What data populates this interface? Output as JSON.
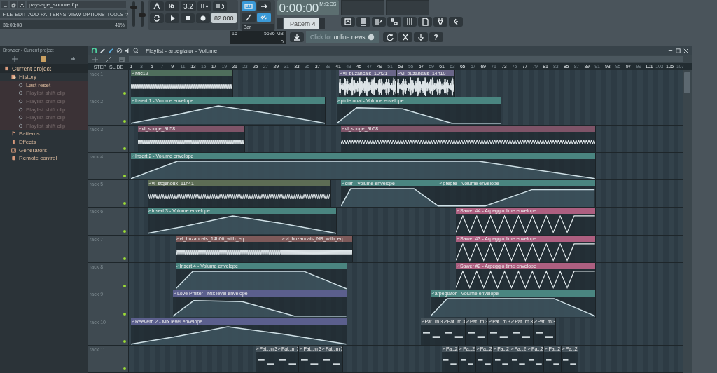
{
  "window": {
    "title": "paysage_sonore.flp"
  },
  "menu": [
    "FILE",
    "EDIT",
    "ADD",
    "PATTERNS",
    "VIEW",
    "OPTIONS",
    "TOOLS",
    "?"
  ],
  "status": {
    "time": "31:03:08",
    "cpu": "41%"
  },
  "master_volume": {
    "level": 0.8
  },
  "master_pitch": {
    "level": 0.45
  },
  "help": "?",
  "transport": {
    "meter": "3.2",
    "tempo": "82.000",
    "snap": "Bar",
    "song_time": "0:00:00",
    "time_unit": "M:S:CS",
    "pattern": "Pattern 4"
  },
  "memory": {
    "polyphony": "16",
    "ram": "5696 MB",
    "value": "0"
  },
  "news": {
    "label": "Click for ",
    "bold": "online news"
  },
  "browser": {
    "title": "Browser - Current project",
    "tree": [
      {
        "label": "Current project",
        "kind": "project",
        "disabled": false,
        "children": [
          {
            "label": "History",
            "kind": "history",
            "disabled": false,
            "children": [
              {
                "label": "Last reset",
                "kind": "step",
                "disabled": false
              },
              {
                "label": "Playlist shift clip",
                "kind": "step",
                "disabled": true
              },
              {
                "label": "Playlist shift clip",
                "kind": "step",
                "disabled": true
              },
              {
                "label": "Playlist shift clip",
                "kind": "step",
                "disabled": true
              },
              {
                "label": "Playlist shift clip",
                "kind": "step",
                "disabled": true
              },
              {
                "label": "Playlist shift clip",
                "kind": "step",
                "disabled": true
              }
            ]
          },
          {
            "label": "Patterns",
            "kind": "patterns",
            "disabled": false
          },
          {
            "label": "Effects",
            "kind": "effects",
            "disabled": false
          },
          {
            "label": "Generators",
            "kind": "generators",
            "disabled": false
          },
          {
            "label": "Remote control",
            "kind": "remote",
            "disabled": false
          }
        ]
      }
    ]
  },
  "playlist": {
    "title": "Playlist - arpegiator - Volume",
    "step_label": "STEP",
    "slide_label": "SLIDE",
    "ruler": [
      "1",
      "3",
      "5",
      "7",
      "9",
      "11",
      "13",
      "15",
      "17",
      "19",
      "21",
      "23",
      "25",
      "27",
      "29",
      "31",
      "33",
      "35",
      "37",
      "39",
      "41",
      "43",
      "45",
      "47",
      "49",
      "51",
      "53",
      "55",
      "57",
      "59",
      "61",
      "63",
      "65",
      "67",
      "69",
      "71",
      "73",
      "75",
      "77",
      "79",
      "81",
      "83",
      "85",
      "87",
      "89",
      "91",
      "93",
      "95",
      "97",
      "99",
      "101",
      "103",
      "105",
      "107"
    ],
    "tracks": [
      {
        "name": "rack 1",
        "enabled": true,
        "clips": [
          {
            "title": "Mic12",
            "kind": "audio",
            "color": "#4f6e5c"
          },
          {
            "title": "vl_buzancais_10h21",
            "kind": "audio",
            "color": "#6a6689"
          },
          {
            "title": "vl_buzancais_14h10",
            "kind": "audio",
            "color": "#6a6689"
          }
        ]
      },
      {
        "name": "rack 2",
        "enabled": true,
        "clips": [
          {
            "title": "Insert 1 - Volume envelope",
            "kind": "envelope",
            "color": "#4a8580"
          },
          {
            "title": "pluie ouai - Volume envelope",
            "kind": "envelope",
            "color": "#4a8580"
          }
        ]
      },
      {
        "name": "rack 3",
        "enabled": true,
        "clips": [
          {
            "title": "vl_souge_9h58",
            "kind": "audio",
            "color": "#7e5468"
          },
          {
            "title": "vl_souge_9h58",
            "kind": "audio",
            "color": "#7e5468"
          }
        ]
      },
      {
        "name": "rack 4",
        "enabled": true,
        "clips": [
          {
            "title": "Insert 2 - Volume envelope",
            "kind": "envelope",
            "color": "#4a8580"
          }
        ]
      },
      {
        "name": "rack 5",
        "enabled": true,
        "clips": [
          {
            "title": "vl_stgenoux_11h41",
            "kind": "audio",
            "color": "#5d6d55"
          },
          {
            "title": "clar - Volume envelope",
            "kind": "envelope",
            "color": "#4a8580"
          },
          {
            "title": "gregre - Volume envelope",
            "kind": "envelope",
            "color": "#4a8580"
          }
        ]
      },
      {
        "name": "rack 6",
        "enabled": true,
        "clips": [
          {
            "title": "Insert 3 - Volume envelope",
            "kind": "envelope",
            "color": "#4a8580"
          },
          {
            "title": "Sawer #4 - Arpeggio time envelope",
            "kind": "arpeggio",
            "color": "#ad5f80"
          }
        ]
      },
      {
        "name": "rack 7",
        "enabled": true,
        "clips": [
          {
            "title": "vl_buzancais_14h06_with_eq",
            "kind": "audio",
            "color": "#7e5a5a"
          },
          {
            "title": "vl_buzancais_NB_with_eq",
            "kind": "audio",
            "color": "#7e5a5a"
          },
          {
            "title": "Sawer #3 - Arpeggio time envelope",
            "kind": "arpeggio",
            "color": "#ad5f80"
          }
        ]
      },
      {
        "name": "rack 8",
        "enabled": true,
        "clips": [
          {
            "title": "Insert 4 - Volume envelope",
            "kind": "envelope",
            "color": "#4a8580"
          },
          {
            "title": "Sawer #2 - Arpeggio time envelope",
            "kind": "arpeggio",
            "color": "#ad5f80"
          }
        ]
      },
      {
        "name": "rack 9",
        "enabled": true,
        "clips": [
          {
            "title": "Love Philter - Mix level envelope",
            "kind": "envelope",
            "color": "#5b5f8d"
          },
          {
            "title": "arpegiator - Volume envelope",
            "kind": "envelope",
            "color": "#4a8580"
          }
        ]
      },
      {
        "name": "rack 10",
        "enabled": true,
        "clips": [
          {
            "title": "Reeverb 2 - Mix level envelope",
            "kind": "envelope",
            "color": "#5b5f8d"
          },
          {
            "title": "Pat...rn 3",
            "kind": "pattern",
            "color": "#46535b"
          },
          {
            "title": "Pat...rn 3",
            "kind": "pattern",
            "color": "#46535b"
          },
          {
            "title": "Pat...rn 3",
            "kind": "pattern",
            "color": "#46535b"
          },
          {
            "title": "Pat...rn 3",
            "kind": "pattern",
            "color": "#46535b"
          },
          {
            "title": "Pat...rn 3",
            "kind": "pattern",
            "color": "#46535b"
          },
          {
            "title": "Pat...rn 3",
            "kind": "pattern",
            "color": "#46535b"
          }
        ]
      },
      {
        "name": "rack 11",
        "enabled": true,
        "clips": [
          {
            "title": "Pat...rn 3",
            "kind": "pattern",
            "color": "#46535b"
          },
          {
            "title": "Pat...rn 3",
            "kind": "pattern",
            "color": "#46535b"
          },
          {
            "title": "Pat...rn 3",
            "kind": "pattern",
            "color": "#46535b"
          },
          {
            "title": "Pat...rn 3",
            "kind": "pattern",
            "color": "#46535b"
          },
          {
            "title": "Pa...2",
            "kind": "pattern",
            "color": "#46535b"
          },
          {
            "title": "Pa...2",
            "kind": "pattern",
            "color": "#46535b"
          },
          {
            "title": "Pa...2",
            "kind": "pattern",
            "color": "#46535b"
          },
          {
            "title": "Pa...2",
            "kind": "pattern",
            "color": "#46535b"
          },
          {
            "title": "Pa...2",
            "kind": "pattern",
            "color": "#46535b"
          },
          {
            "title": "Pa...2",
            "kind": "pattern",
            "color": "#46535b"
          },
          {
            "title": "Pa...2",
            "kind": "pattern",
            "color": "#46535b"
          },
          {
            "title": "Pa...2",
            "kind": "pattern",
            "color": "#46535b"
          }
        ]
      }
    ]
  }
}
